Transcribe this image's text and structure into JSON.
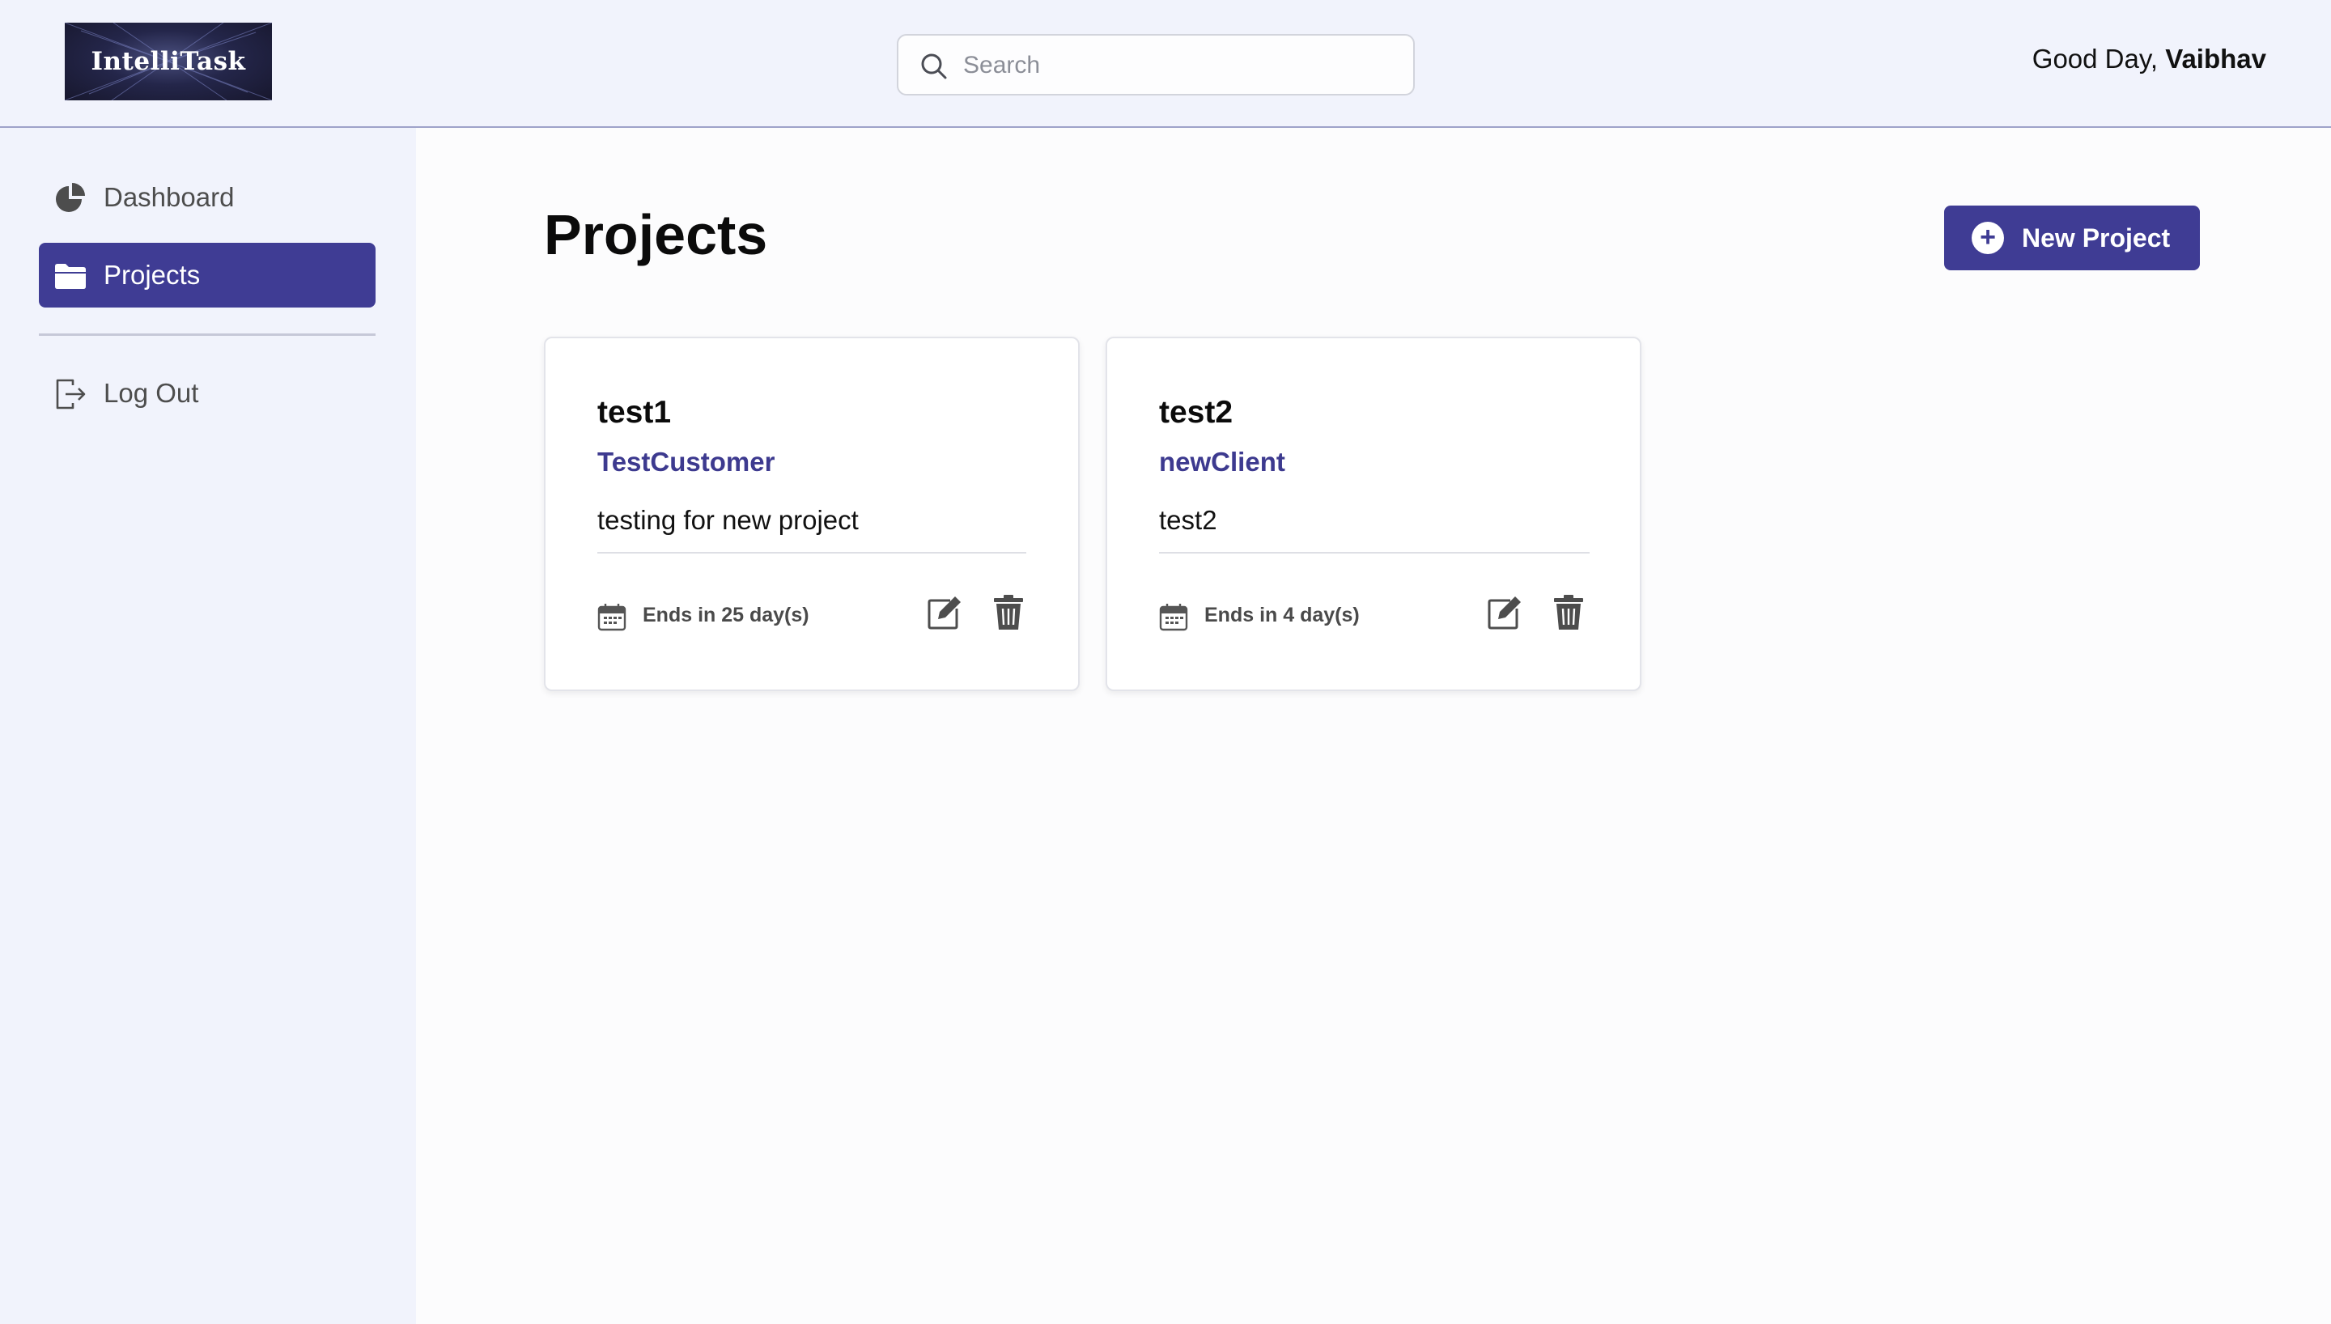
{
  "header": {
    "logo_text": "IntelliTask",
    "search_placeholder": "Search",
    "greeting_prefix": "Good Day,",
    "user_name": "Vaibhav"
  },
  "sidebar": {
    "items": [
      {
        "label": "Dashboard",
        "icon": "pie-chart-icon",
        "active": false
      },
      {
        "label": "Projects",
        "icon": "folder-icon",
        "active": true
      },
      {
        "label": "Log Out",
        "icon": "logout-icon",
        "active": false
      }
    ]
  },
  "main": {
    "title": "Projects",
    "new_project_label": "New Project",
    "projects": [
      {
        "name": "test1",
        "client": "TestCustomer",
        "description": "testing for new project",
        "ends": "Ends in 25 day(s)"
      },
      {
        "name": "test2",
        "client": "newClient",
        "description": "test2",
        "ends": "Ends in 4 day(s)"
      }
    ]
  },
  "colors": {
    "accent": "#3f3c94",
    "sidebar_bg": "#f1f3fc",
    "client_text": "#3d3a8f"
  }
}
